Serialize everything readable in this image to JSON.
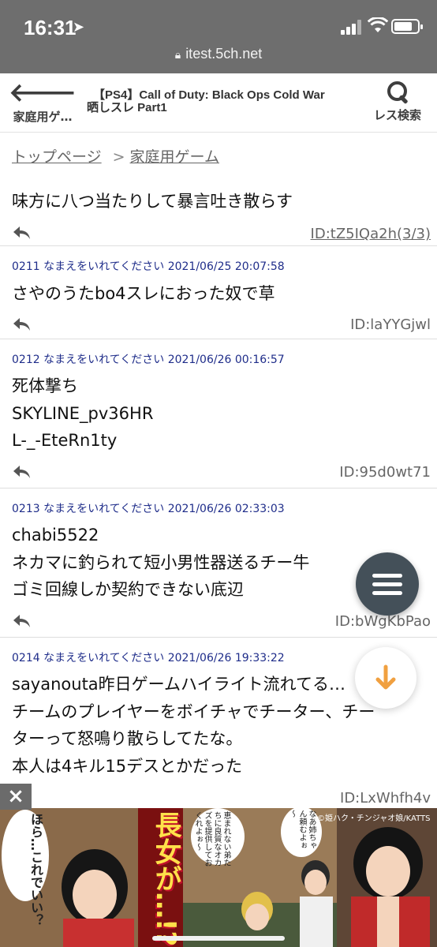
{
  "status_bar": {
    "time": "16:31",
    "url": "itest.5ch.net"
  },
  "header": {
    "back_label": "家庭用ゲ…",
    "title_line1": "【PS4】Call of Duty: Black Ops Cold War",
    "title_line2": "晒しスレ Part1",
    "search_label": "レス検索"
  },
  "breadcrumb": {
    "top": "トップページ",
    "separator": ">",
    "category": "家庭用ゲーム"
  },
  "clipped_text": "味方に八つ当たりして暴言吐き散らす",
  "clipped_post": {
    "id": "ID:tZ5IQa2h(3/3)"
  },
  "posts": [
    {
      "meta": "0211 なまえをいれてください 2021/06/25 20:07:58",
      "lines": [
        "さやのうたbo4スレにおった奴で草"
      ],
      "id": "ID:laYYGjwl"
    },
    {
      "meta": "0212 なまえをいれてください 2021/06/26 00:16:57",
      "lines": [
        "死体撃ち",
        "SKYLINE_pv36HR",
        "L-_-EteRn1ty"
      ],
      "id": "ID:95d0wt71"
    },
    {
      "meta": "0213 なまえをいれてください 2021/06/26 02:33:03",
      "lines": [
        "chabi5522",
        "ネカマに釣られて短小男性器送るチー牛",
        "ゴミ回線しか契約できない底辺"
      ],
      "id": "ID:bWgKbPao"
    },
    {
      "meta": "0214 なまえをいれてください 2021/06/26 19:33:22",
      "lines": [
        "sayanouta昨日ゲームハイライト流れてる…",
        "チームのプレイヤーをボイチャでチーター、チー",
        "ターって怒鳴り散らしてたな。",
        "本人は4キル15デスとかだった"
      ],
      "id": "ID:LxWhfh4v"
    }
  ],
  "ad": {
    "bubble_left": "ほら…これでいい？",
    "headline": "長女が…!?",
    "bubble_mid": "恵まれない弟たちに良質なオカズを提供しておくれよぉ～",
    "bubble_right": "なあ姉ちゃん頼むよぉ～",
    "credit": "©姫ハク・チンジャオ娘/KATTS",
    "close": "×"
  },
  "icons": {
    "back": "arrow-left-icon",
    "search": "search-icon",
    "reply": "reply-icon",
    "menu": "menu-icon",
    "scroll_down": "arrow-down-icon"
  },
  "colors": {
    "meta_text": "#1f2d8a",
    "fab_bg": "#445059",
    "down_arrow": "#f0a040",
    "status_bar": "#6e6e6e"
  }
}
